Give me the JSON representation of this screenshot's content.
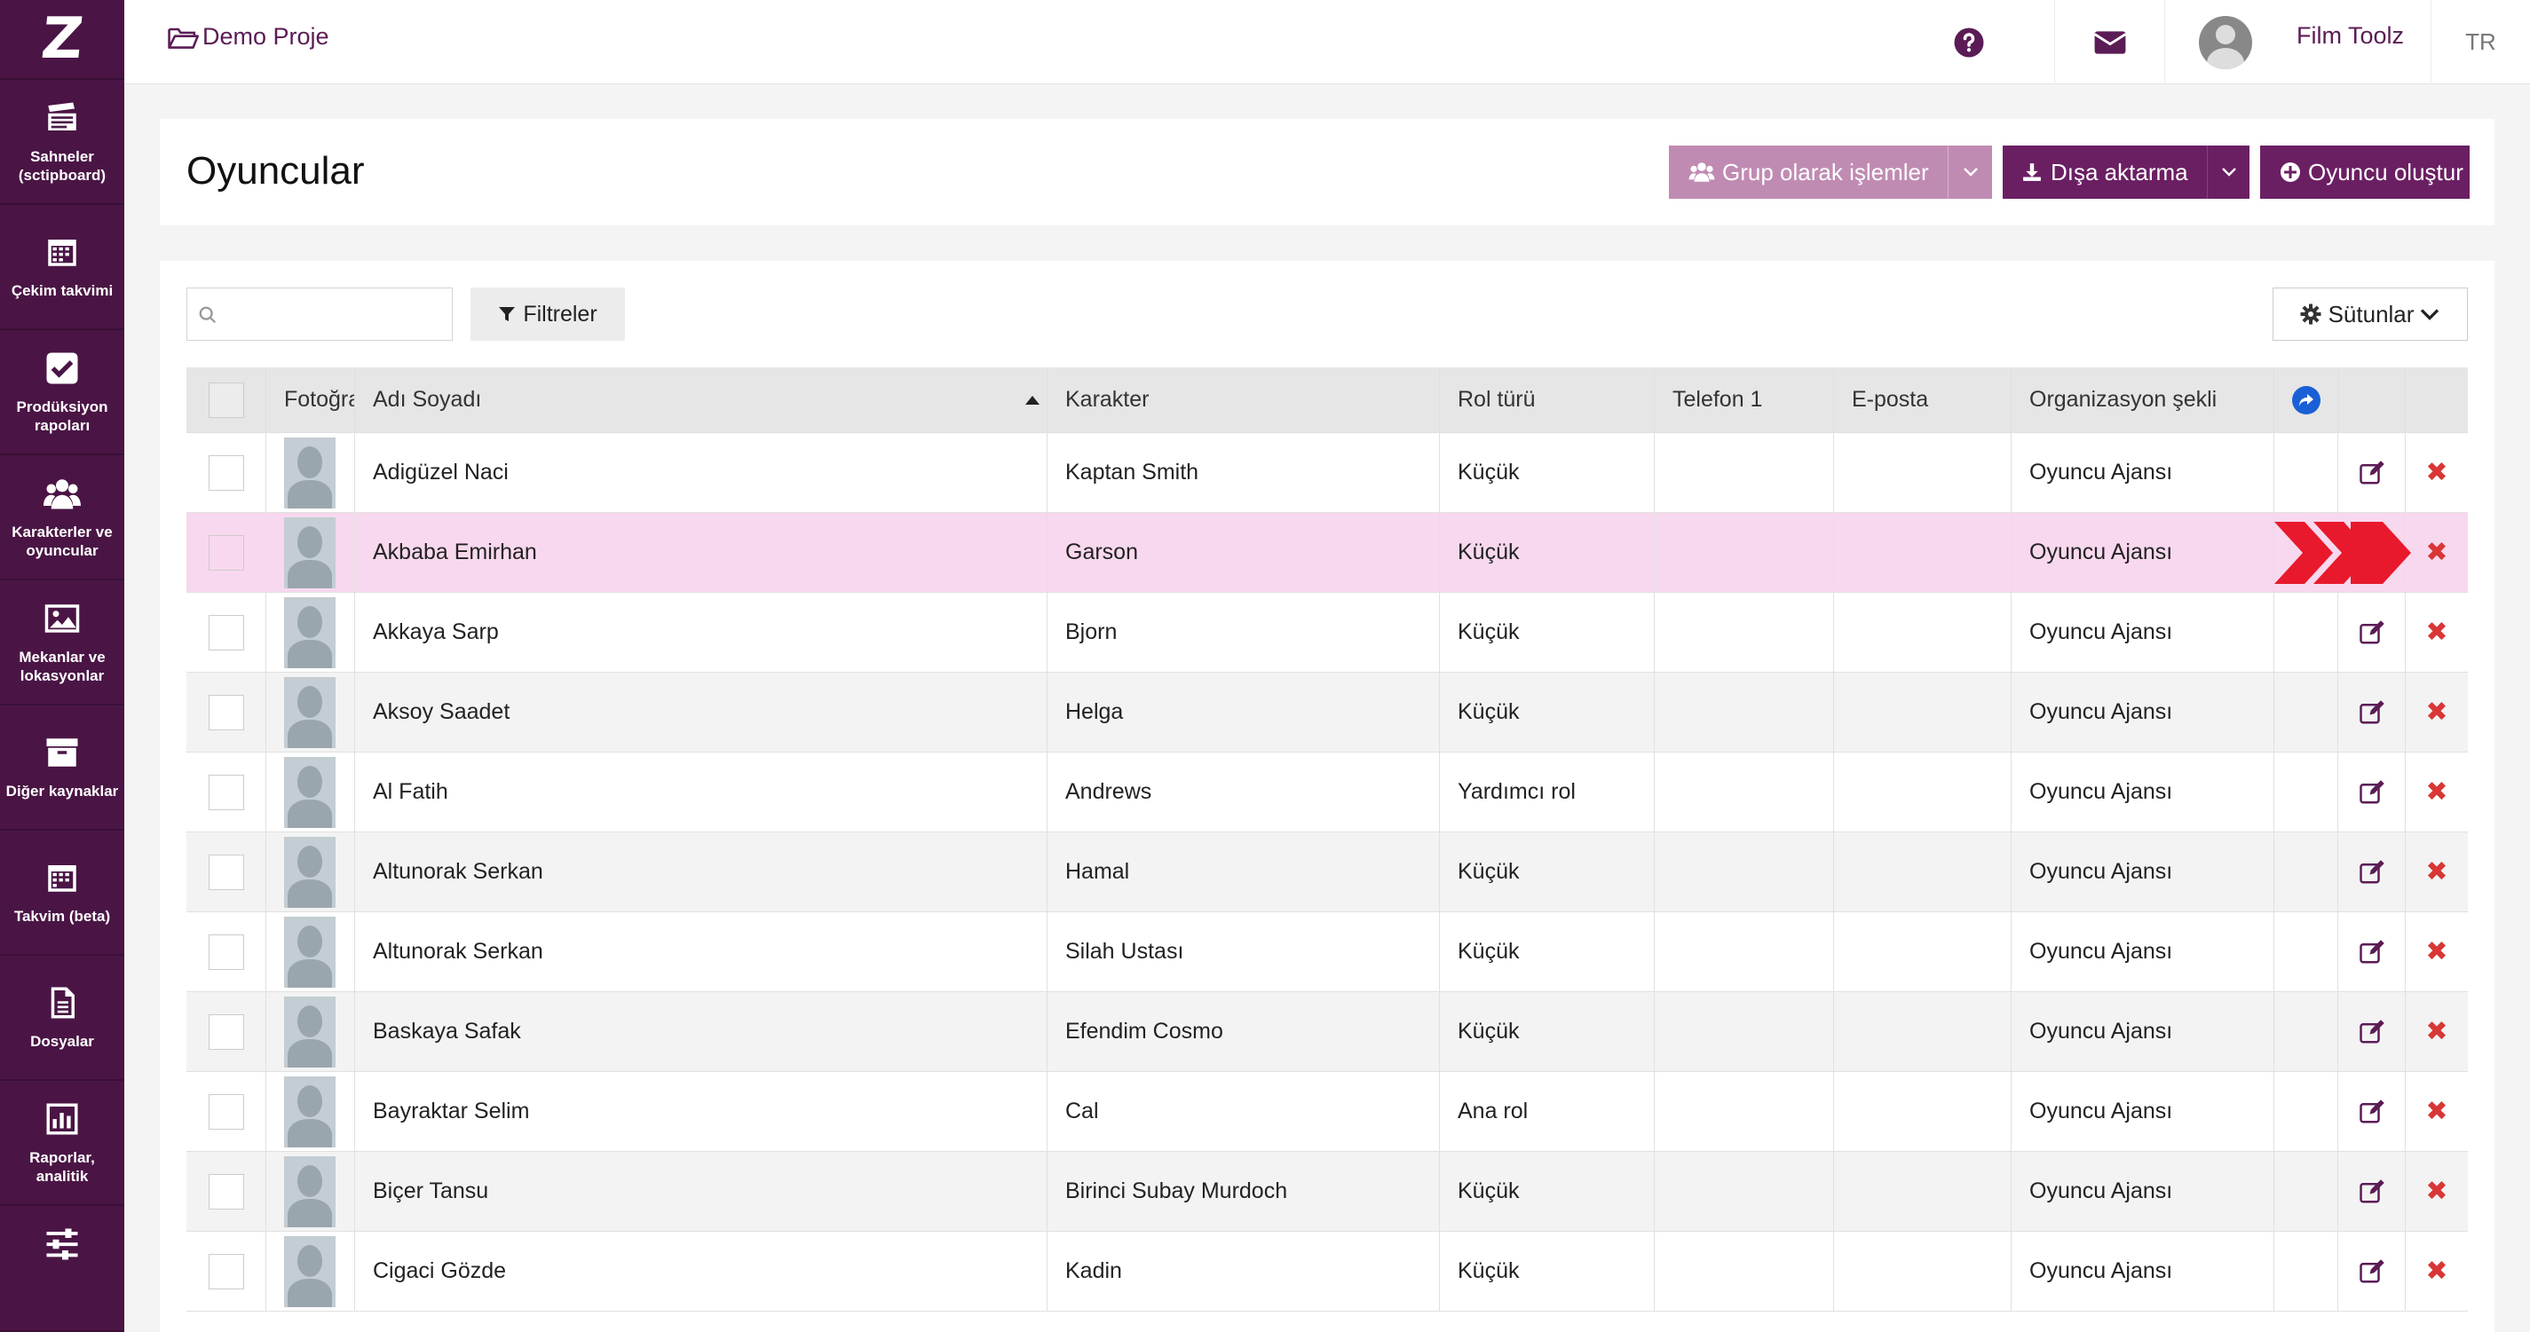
{
  "sidebar": {
    "logo": "Z",
    "items": [
      {
        "label": "Sahneler (sctipboard)",
        "icon": "clapperboard-icon"
      },
      {
        "label": "Çekim takvimi",
        "icon": "calendar-grid-icon"
      },
      {
        "label": "Prodüksiyon rapoları",
        "icon": "checkbox-icon"
      },
      {
        "label": "Karakterler ve oyuncular",
        "icon": "users-icon"
      },
      {
        "label": "Mekanlar ve lokasyonlar",
        "icon": "image-icon"
      },
      {
        "label": "Diğer kaynaklar",
        "icon": "archive-box-icon"
      },
      {
        "label": "Takvim (beta)",
        "icon": "calendar-icon"
      },
      {
        "label": "Dosyalar",
        "icon": "document-icon"
      },
      {
        "label": "Raporlar, analitik",
        "icon": "bar-chart-icon"
      },
      {
        "label": "",
        "icon": "sliders-icon"
      }
    ]
  },
  "topbar": {
    "breadcrumb": "Demo Proje",
    "user_name": "Film Toolz",
    "language": "TR"
  },
  "header": {
    "title": "Oyuncular",
    "group_actions": "Grup olarak işlemler",
    "export": "Dışa aktarma",
    "create": "Oyuncu oluştur"
  },
  "toolbar": {
    "search_placeholder": "",
    "filters": "Filtreler",
    "columns": "Sütunlar"
  },
  "table": {
    "columns": {
      "photo": "Fotoğra",
      "name": "Adı Soyadı",
      "character": "Karakter",
      "role": "Rol türü",
      "phone": "Telefon 1",
      "email": "E-posta",
      "org": "Organizasyon şekli"
    },
    "rows": [
      {
        "name": "Adigüzel Naci",
        "character": "Kaptan Smith",
        "role": "Küçük",
        "phone": "",
        "email": "",
        "org": "Oyuncu Ajansı"
      },
      {
        "name": "Akbaba Emirhan",
        "character": "Garson",
        "role": "Küçük",
        "phone": "",
        "email": "",
        "org": "Oyuncu Ajansı"
      },
      {
        "name": "Akkaya Sarp",
        "character": "Bjorn",
        "role": "Küçük",
        "phone": "",
        "email": "",
        "org": "Oyuncu Ajansı"
      },
      {
        "name": "Aksoy Saadet",
        "character": "Helga",
        "role": "Küçük",
        "phone": "",
        "email": "",
        "org": "Oyuncu Ajansı"
      },
      {
        "name": "Al Fatih",
        "character": "Andrews",
        "role": "Yardımcı rol",
        "phone": "",
        "email": "",
        "org": "Oyuncu Ajansı"
      },
      {
        "name": "Altunorak Serkan",
        "character": "Hamal",
        "role": "Küçük",
        "phone": "",
        "email": "",
        "org": "Oyuncu Ajansı"
      },
      {
        "name": "Altunorak Serkan",
        "character": "Silah Ustası",
        "role": "Küçük",
        "phone": "",
        "email": "",
        "org": "Oyuncu Ajansı"
      },
      {
        "name": "Baskaya Safak",
        "character": "Efendim Cosmo",
        "role": "Küçük",
        "phone": "",
        "email": "",
        "org": "Oyuncu Ajansı"
      },
      {
        "name": "Bayraktar Selim",
        "character": "Cal",
        "role": "Ana rol",
        "phone": "",
        "email": "",
        "org": "Oyuncu Ajansı"
      },
      {
        "name": "Biçer Tansu",
        "character": "Birinci Subay Murdoch",
        "role": "Küçük",
        "phone": "",
        "email": "",
        "org": "Oyuncu Ajansı"
      },
      {
        "name": "Cigaci Gözde",
        "character": "Kadin",
        "role": "Küçük",
        "phone": "",
        "email": "",
        "org": "Oyuncu Ajansı"
      }
    ],
    "highlighted_row": 1
  },
  "colors": {
    "sidebar_bg": "#4a1545",
    "accent": "#6b1f63",
    "accent_light": "#c08bb3",
    "highlight_row": "#f8d8ee",
    "delete": "#d93636",
    "share": "#1a5fd6",
    "arrow": "#e8192c"
  }
}
